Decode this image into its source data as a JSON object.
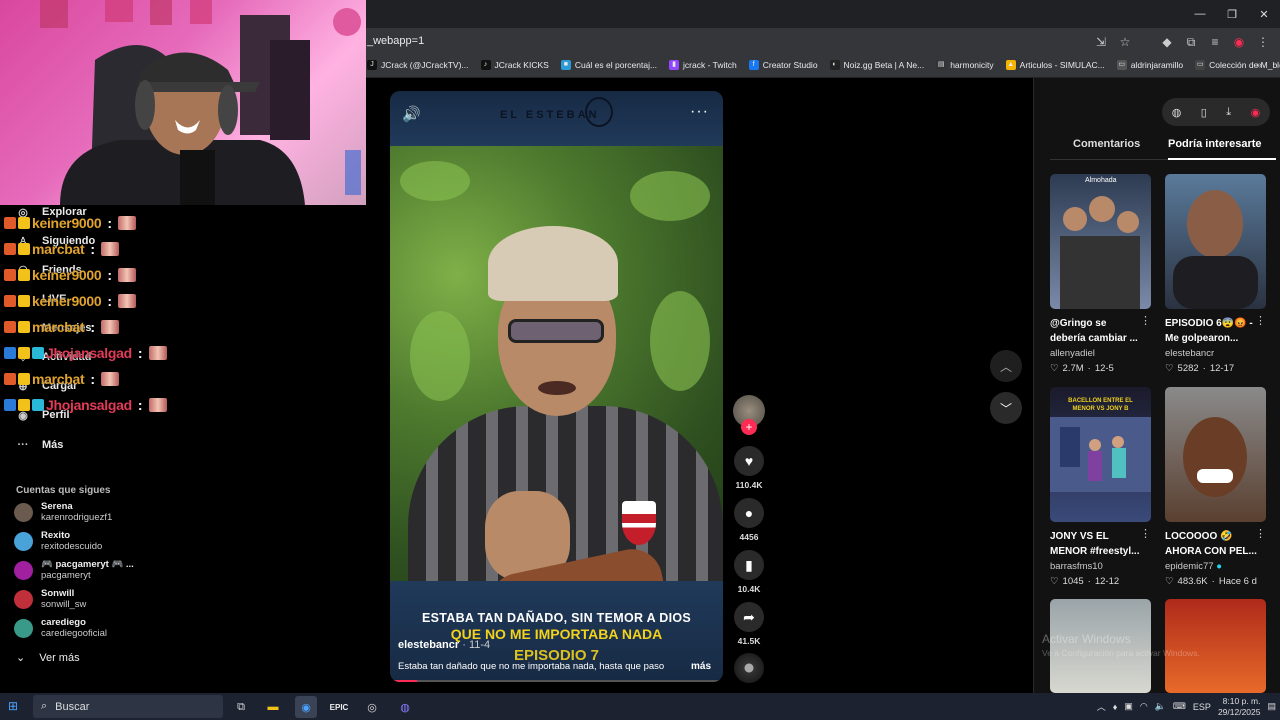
{
  "browser": {
    "url_fragment": "_webapp=1",
    "window_controls": {
      "minimize": "—",
      "restore": "❐",
      "close": "✕"
    },
    "bookmarks": [
      {
        "label": "JCrack (@JCrackTV)...",
        "color": "#111111",
        "icon": "J"
      },
      {
        "label": "JCrack KICKS",
        "color": "#111111",
        "icon": "♪"
      },
      {
        "label": "Cuál es el porcentaj...",
        "color": "#2b9bd8",
        "icon": "■"
      },
      {
        "label": "jcrack - Twitch",
        "color": "#9146ff",
        "icon": "▮"
      },
      {
        "label": "Creator Studio",
        "color": "#1877f2",
        "icon": "f"
      },
      {
        "label": "Noiz.gg Beta | A Ne...",
        "color": "#222222",
        "icon": "◐"
      },
      {
        "label": "harmonicity",
        "color": "#333333",
        "icon": "▤"
      },
      {
        "label": "Articulos - SIMULAC...",
        "color": "#f4b400",
        "icon": "▲"
      },
      {
        "label": "aldrinjaramillo",
        "color": "#555555",
        "icon": "▭"
      },
      {
        "label": "Colección de M_blei...",
        "color": "#444444",
        "icon": "▭"
      }
    ],
    "bookmarks_more": "»"
  },
  "sidebar": {
    "nav": [
      {
        "label": "Explorar",
        "icon": "compass-icon",
        "glyph": "◎"
      },
      {
        "label": "Siguiendo",
        "icon": "following-icon",
        "glyph": "♙"
      },
      {
        "label": "Friends",
        "icon": "friends-icon",
        "glyph": "⚇"
      },
      {
        "label": "LIVE",
        "icon": "live-icon",
        "glyph": "▣"
      },
      {
        "label": "Mensajes",
        "icon": "messages-icon",
        "glyph": "✉"
      },
      {
        "label": "Actividad",
        "icon": "activity-icon",
        "glyph": "♡"
      },
      {
        "label": "Cargar",
        "icon": "upload-icon",
        "glyph": "⊕"
      },
      {
        "label": "Perfil",
        "icon": "profile-icon",
        "glyph": "◉"
      },
      {
        "label": "Más",
        "icon": "more-icon",
        "glyph": "···"
      }
    ],
    "following_title": "Cuentas que sigues",
    "accounts": [
      {
        "name": "Serena",
        "handle": "karenrodriguezf1",
        "color": "#6b5a4e"
      },
      {
        "name": "Rexito",
        "handle": "rexitodescuido",
        "color": "#4aa3d8"
      },
      {
        "name": "🎮 pacgameryt 🎮 ...",
        "handle": "pacgameryt",
        "color": "#a020a0"
      },
      {
        "name": "Sonwill",
        "handle": "sonwill_sw",
        "color": "#c0303a"
      },
      {
        "name": "carediego",
        "handle": "carediegooficial",
        "color": "#3a9a8a"
      }
    ],
    "see_more": "Ver más"
  },
  "chat": [
    {
      "user": "keiner9000",
      "color": "y"
    },
    {
      "user": "marcbat",
      "color": "y"
    },
    {
      "user": "keiner9000",
      "color": "y"
    },
    {
      "user": "keiner9000",
      "color": "y"
    },
    {
      "user": "marcbat",
      "color": "y"
    },
    {
      "user": "Jhojansalgad",
      "color": "r"
    },
    {
      "user": "marcbat",
      "color": "y"
    },
    {
      "user": "Jhojansalgad",
      "color": "r"
    }
  ],
  "video": {
    "brand": "EL ESTEBAN",
    "caption_line1": "ESTABA TAN DAÑADO, SIN TEMOR A DIOS",
    "caption_line2": "QUE NO ME IMPORTABA NADA",
    "caption_line3": "EPISODIO 7",
    "author": "elestebancr",
    "date": "· 11-4",
    "description": "Estaba tan dañado que no me importaba nada, hasta que paso",
    "more_label": "más",
    "progress": 0.07
  },
  "actions": {
    "likes": "110.4K",
    "comments": "4456",
    "saves": "10.4K",
    "shares": "41.5K"
  },
  "right_panel": {
    "tabs": [
      "Comentarios",
      "Podría interesarte"
    ],
    "active_tab": 1,
    "cards": [
      {
        "title": "@Gringo se debería cambiar ...",
        "author": "allenyadiel",
        "likes": "2.7M",
        "date": "12-5",
        "thumb_label": "Almohada",
        "c1": "#2d3b52",
        "c2": "#7a8aa8"
      },
      {
        "title": "EPISODIO 6😨😡 - Me golpearon...",
        "author": "elestebancr",
        "likes": "5282",
        "date": "12-17",
        "thumb_label": "",
        "c1": "#5a7a9a",
        "c2": "#2a3240"
      },
      {
        "title": "JONY VS EL MENOR #freestyl...",
        "author": "barrasfms10",
        "likes": "1045",
        "date": "12-12",
        "thumb_label": "BACELLON ENTRE EL MENOR VS JONY B",
        "c1": "#1a1a2a",
        "c2": "#3a4a7a"
      },
      {
        "title": "LOCOOOO 🤣 AHORA CON PEL...",
        "author": "epidemic77",
        "likes": "483.6K",
        "date": "Hace 6 d",
        "thumb_label": "",
        "c1": "#8a8a8a",
        "c2": "#5a4030"
      },
      {
        "title": "",
        "author": "",
        "likes": "",
        "date": "",
        "thumb_label": "",
        "c1": "#9aa4a8",
        "c2": "#d8d8d0"
      },
      {
        "title": "",
        "author": "",
        "likes": "",
        "date": "",
        "thumb_label": "",
        "c1": "#b02a1a",
        "c2": "#e86a2a"
      }
    ]
  },
  "watermark": {
    "line1": "Activar Windows",
    "line2": "Ve a Configuración para activar Windows."
  },
  "taskbar": {
    "search_placeholder": "Buscar",
    "lang": "ESP",
    "time": "8:10 p. m.",
    "date": "29/12/2025"
  }
}
